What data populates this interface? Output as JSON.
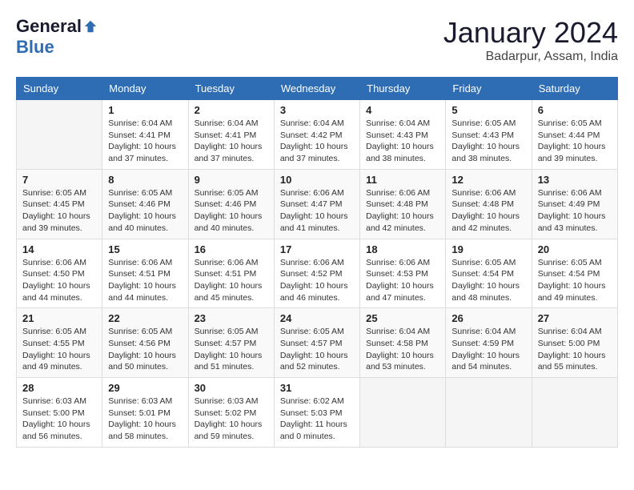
{
  "header": {
    "logo_general": "General",
    "logo_blue": "Blue",
    "month_title": "January 2024",
    "location": "Badarpur, Assam, India"
  },
  "calendar": {
    "days_of_week": [
      "Sunday",
      "Monday",
      "Tuesday",
      "Wednesday",
      "Thursday",
      "Friday",
      "Saturday"
    ],
    "weeks": [
      [
        {
          "day": "",
          "detail": ""
        },
        {
          "day": "1",
          "detail": "Sunrise: 6:04 AM\nSunset: 4:41 PM\nDaylight: 10 hours\nand 37 minutes."
        },
        {
          "day": "2",
          "detail": "Sunrise: 6:04 AM\nSunset: 4:41 PM\nDaylight: 10 hours\nand 37 minutes."
        },
        {
          "day": "3",
          "detail": "Sunrise: 6:04 AM\nSunset: 4:42 PM\nDaylight: 10 hours\nand 37 minutes."
        },
        {
          "day": "4",
          "detail": "Sunrise: 6:04 AM\nSunset: 4:43 PM\nDaylight: 10 hours\nand 38 minutes."
        },
        {
          "day": "5",
          "detail": "Sunrise: 6:05 AM\nSunset: 4:43 PM\nDaylight: 10 hours\nand 38 minutes."
        },
        {
          "day": "6",
          "detail": "Sunrise: 6:05 AM\nSunset: 4:44 PM\nDaylight: 10 hours\nand 39 minutes."
        }
      ],
      [
        {
          "day": "7",
          "detail": "Sunrise: 6:05 AM\nSunset: 4:45 PM\nDaylight: 10 hours\nand 39 minutes."
        },
        {
          "day": "8",
          "detail": "Sunrise: 6:05 AM\nSunset: 4:46 PM\nDaylight: 10 hours\nand 40 minutes."
        },
        {
          "day": "9",
          "detail": "Sunrise: 6:05 AM\nSunset: 4:46 PM\nDaylight: 10 hours\nand 40 minutes."
        },
        {
          "day": "10",
          "detail": "Sunrise: 6:06 AM\nSunset: 4:47 PM\nDaylight: 10 hours\nand 41 minutes."
        },
        {
          "day": "11",
          "detail": "Sunrise: 6:06 AM\nSunset: 4:48 PM\nDaylight: 10 hours\nand 42 minutes."
        },
        {
          "day": "12",
          "detail": "Sunrise: 6:06 AM\nSunset: 4:48 PM\nDaylight: 10 hours\nand 42 minutes."
        },
        {
          "day": "13",
          "detail": "Sunrise: 6:06 AM\nSunset: 4:49 PM\nDaylight: 10 hours\nand 43 minutes."
        }
      ],
      [
        {
          "day": "14",
          "detail": "Sunrise: 6:06 AM\nSunset: 4:50 PM\nDaylight: 10 hours\nand 44 minutes."
        },
        {
          "day": "15",
          "detail": "Sunrise: 6:06 AM\nSunset: 4:51 PM\nDaylight: 10 hours\nand 44 minutes."
        },
        {
          "day": "16",
          "detail": "Sunrise: 6:06 AM\nSunset: 4:51 PM\nDaylight: 10 hours\nand 45 minutes."
        },
        {
          "day": "17",
          "detail": "Sunrise: 6:06 AM\nSunset: 4:52 PM\nDaylight: 10 hours\nand 46 minutes."
        },
        {
          "day": "18",
          "detail": "Sunrise: 6:06 AM\nSunset: 4:53 PM\nDaylight: 10 hours\nand 47 minutes."
        },
        {
          "day": "19",
          "detail": "Sunrise: 6:05 AM\nSunset: 4:54 PM\nDaylight: 10 hours\nand 48 minutes."
        },
        {
          "day": "20",
          "detail": "Sunrise: 6:05 AM\nSunset: 4:54 PM\nDaylight: 10 hours\nand 49 minutes."
        }
      ],
      [
        {
          "day": "21",
          "detail": "Sunrise: 6:05 AM\nSunset: 4:55 PM\nDaylight: 10 hours\nand 49 minutes."
        },
        {
          "day": "22",
          "detail": "Sunrise: 6:05 AM\nSunset: 4:56 PM\nDaylight: 10 hours\nand 50 minutes."
        },
        {
          "day": "23",
          "detail": "Sunrise: 6:05 AM\nSunset: 4:57 PM\nDaylight: 10 hours\nand 51 minutes."
        },
        {
          "day": "24",
          "detail": "Sunrise: 6:05 AM\nSunset: 4:57 PM\nDaylight: 10 hours\nand 52 minutes."
        },
        {
          "day": "25",
          "detail": "Sunrise: 6:04 AM\nSunset: 4:58 PM\nDaylight: 10 hours\nand 53 minutes."
        },
        {
          "day": "26",
          "detail": "Sunrise: 6:04 AM\nSunset: 4:59 PM\nDaylight: 10 hours\nand 54 minutes."
        },
        {
          "day": "27",
          "detail": "Sunrise: 6:04 AM\nSunset: 5:00 PM\nDaylight: 10 hours\nand 55 minutes."
        }
      ],
      [
        {
          "day": "28",
          "detail": "Sunrise: 6:03 AM\nSunset: 5:00 PM\nDaylight: 10 hours\nand 56 minutes."
        },
        {
          "day": "29",
          "detail": "Sunrise: 6:03 AM\nSunset: 5:01 PM\nDaylight: 10 hours\nand 58 minutes."
        },
        {
          "day": "30",
          "detail": "Sunrise: 6:03 AM\nSunset: 5:02 PM\nDaylight: 10 hours\nand 59 minutes."
        },
        {
          "day": "31",
          "detail": "Sunrise: 6:02 AM\nSunset: 5:03 PM\nDaylight: 11 hours\nand 0 minutes."
        },
        {
          "day": "",
          "detail": ""
        },
        {
          "day": "",
          "detail": ""
        },
        {
          "day": "",
          "detail": ""
        }
      ]
    ]
  }
}
